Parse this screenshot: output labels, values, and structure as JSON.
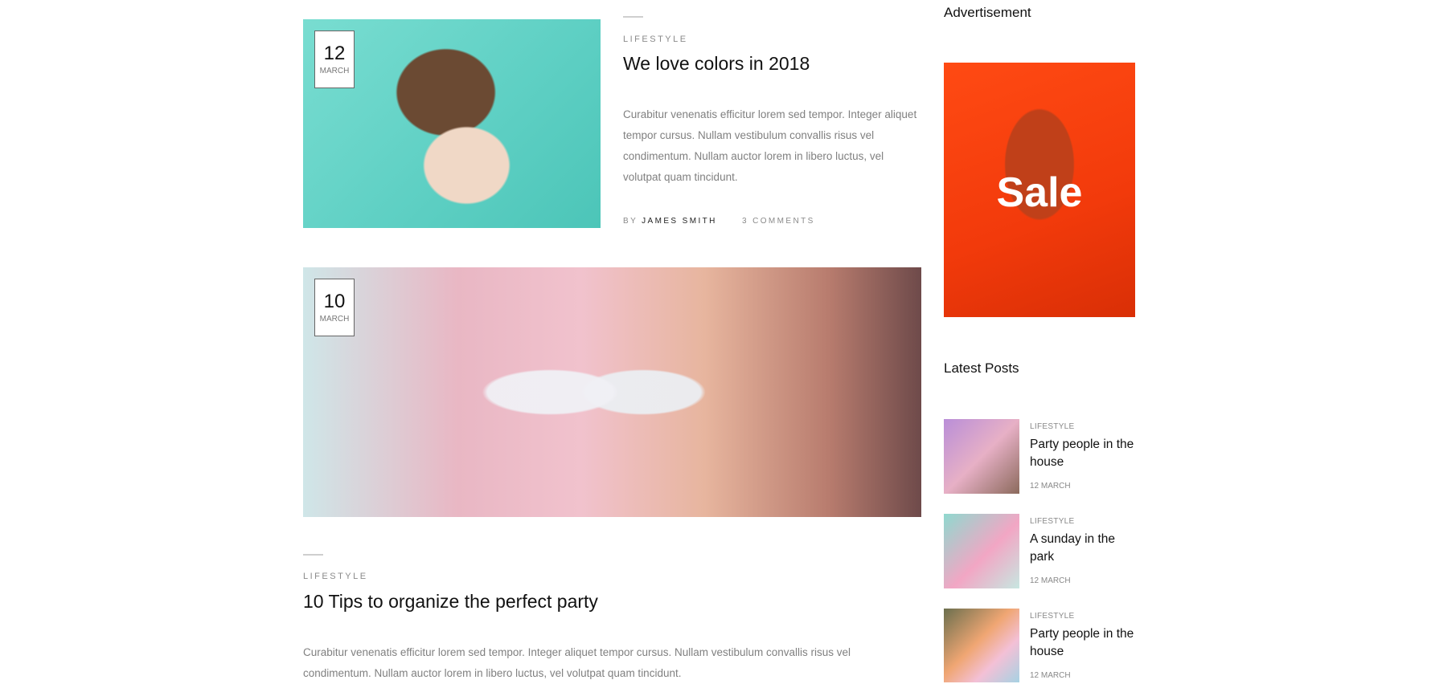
{
  "posts": [
    {
      "day": "12",
      "month": "MARCH",
      "category": "LIFESTYLE",
      "title": "We love colors in 2018",
      "excerpt": "Curabitur venenatis efficitur lorem sed tempor. Integer aliquet tempor cursus. Nullam vestibulum convallis risus vel condimentum. Nullam auctor lorem in libero luctus, vel volutpat quam tincidunt.",
      "by_label": "BY",
      "author": "JAMES SMITH",
      "comments": "3 COMMENTS"
    },
    {
      "day": "10",
      "month": "MARCH",
      "category": "LIFESTYLE",
      "title": "10 Tips to organize the perfect party",
      "excerpt": "Curabitur venenatis efficitur lorem sed tempor. Integer aliquet tempor cursus. Nullam vestibulum convallis risus vel condimentum. Nullam auctor lorem in libero luctus, vel volutpat quam tincidunt."
    }
  ],
  "sidebar": {
    "advertisement_heading": "Advertisement",
    "ad_text": "Sale",
    "latest_posts_heading": "Latest Posts",
    "latest_posts": [
      {
        "category": "LIFESTYLE",
        "title": "Party people in the house",
        "date": "12 MARCH"
      },
      {
        "category": "LIFESTYLE",
        "title": "A sunday in the park",
        "date": "12 MARCH"
      },
      {
        "category": "LIFESTYLE",
        "title": "Party people in the house",
        "date": "12 MARCH"
      }
    ]
  }
}
